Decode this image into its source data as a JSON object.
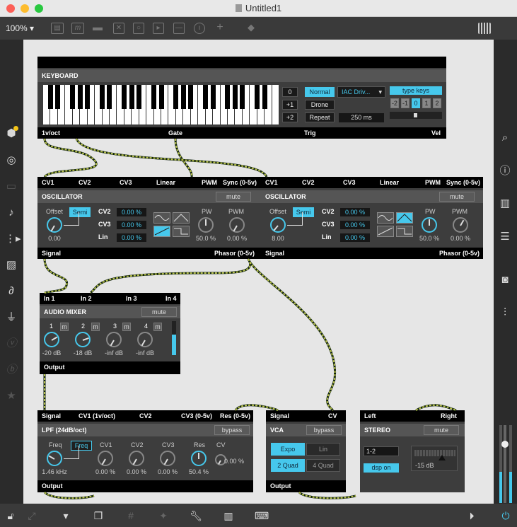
{
  "window": {
    "title": "Untitled1",
    "zoom": "100%"
  },
  "colors": {
    "accent": "#46c8ec",
    "cable": "#b8c24a"
  },
  "toolbar_icons": [
    "presentation-icon",
    "comment-icon",
    "message-icon",
    "toggle-icon",
    "button-icon",
    "play-icon",
    "slider-icon",
    "dial-icon",
    "plus-icon",
    "paint-bucket-icon",
    "grid-icon"
  ],
  "keyboard": {
    "title": "KEYBOARD",
    "octaves": [
      "0",
      "+1",
      "+2"
    ],
    "modes": [
      "Normal",
      "Drone",
      "Repeat"
    ],
    "midi_device": "IAC Driv...",
    "repeat_time": "250 ms",
    "type_keys": "type keys",
    "transpose": [
      "-2",
      "-1",
      "0",
      "1",
      "2"
    ],
    "outputs": [
      "1v/oct",
      "Gate",
      "Trig",
      "Vel"
    ]
  },
  "osc1": {
    "inputs": [
      "CV1",
      "CV2",
      "CV3",
      "Linear",
      "PWM",
      "Sync (0-5v)"
    ],
    "title": "OSCILLATOR",
    "mute": "mute",
    "offset_label": "Offset",
    "semi": "Semi",
    "offset_value": "0.00",
    "cv2_label": "CV2",
    "cv2": "0.00 %",
    "cv3_label": "CV3",
    "cv3": "0.00 %",
    "lin_label": "Lin",
    "lin": "0.00 %",
    "pw_label": "PW",
    "pw": "50.0 %",
    "pwm_label": "PWM",
    "pwm": "0.00 %",
    "outputs": [
      "Signal",
      "Phasor (0-5v)"
    ]
  },
  "osc2": {
    "inputs": [
      "CV1",
      "CV2",
      "CV3",
      "Linear",
      "PWM",
      "Sync (0-5v)"
    ],
    "title": "OSCILLATOR",
    "mute": "mute",
    "offset_label": "Offset",
    "semi": "Semi",
    "offset_value": "8.00",
    "cv2_label": "CV2",
    "cv2": "0.00 %",
    "cv3_label": "CV3",
    "cv3": "0.00 %",
    "lin_label": "Lin",
    "lin": "0.00 %",
    "pw_label": "PW",
    "pw": "50.0 %",
    "pwm_label": "PWM",
    "pwm": "0.00 %",
    "outputs": [
      "Signal",
      "Phasor (0-5v)"
    ]
  },
  "mixer": {
    "inputs": [
      "In 1",
      "In 2",
      "In 3",
      "In 4"
    ],
    "title": "AUDIO MIXER",
    "mute": "mute",
    "channels": [
      {
        "n": "1",
        "m": "m",
        "db": "-20 dB"
      },
      {
        "n": "2",
        "m": "m",
        "db": "-18 dB"
      },
      {
        "n": "3",
        "m": "m",
        "db": "-inf dB"
      },
      {
        "n": "4",
        "m": "m",
        "db": "-inf dB"
      }
    ],
    "output": "Output",
    "meter_level": 0.6
  },
  "lpf": {
    "inputs": [
      "Signal",
      "CV1 (1v/oct)",
      "CV2",
      "CV3 (0-5v)",
      "Res (0-5v)"
    ],
    "title": "LPF (24dB/oct)",
    "bypass": "bypass",
    "freq_label": "Freq",
    "freq_btn": "Freq",
    "freq": "1.46 kHz",
    "cv1_label": "CV1",
    "cv1": "0.00 %",
    "cv2_label": "CV2",
    "cv2": "0.00 %",
    "cv3_label": "CV3",
    "cv3": "0.00 %",
    "res_label": "Res",
    "res": "50.4 %",
    "cv_label": "CV",
    "cv": "0.00 %",
    "output": "Output"
  },
  "vca": {
    "inputs": [
      "Signal",
      "CV"
    ],
    "title": "VCA",
    "bypass": "bypass",
    "modes": [
      "Expo",
      "Lin",
      "2 Quad",
      "4 Quad"
    ],
    "output": "Output"
  },
  "stereo": {
    "inputs": [
      "Left",
      "Right"
    ],
    "title": "STEREO",
    "mute": "mute",
    "channels": "1-2",
    "dsp": "dsp on",
    "gain": "-15 dB"
  },
  "left_sidebar": [
    "cube-icon",
    "target-icon",
    "keyboard-icon",
    "music-note-icon",
    "step-sequencer-icon",
    "image-icon",
    "paperclip-icon",
    "plug-icon",
    "v-icon",
    "b-icon",
    "star-icon"
  ],
  "right_sidebar": [
    "search-icon",
    "info-icon",
    "book-icon",
    "list-icon",
    "camera-icon",
    "sliders-icon"
  ],
  "bottom_icons": [
    "lock-icon",
    "edit-icon",
    "presentation-mode-icon",
    "windows-icon",
    "grid-icon",
    "pin-icon",
    "wrench-icon",
    "piano-icon",
    "keyboard-icon",
    "play-circle-icon",
    "power-icon"
  ]
}
